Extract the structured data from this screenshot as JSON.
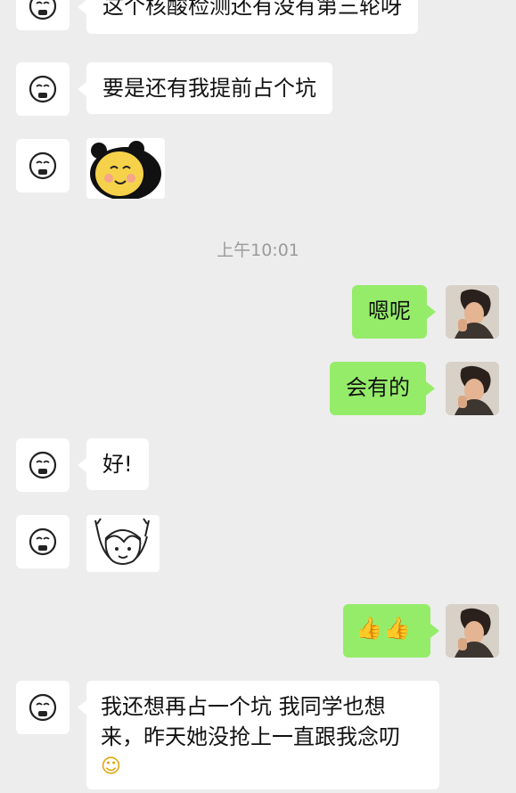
{
  "conversation": {
    "timestamp": "上午10:01",
    "messages": [
      {
        "side": "left",
        "text": "这个核酸检测还有没有第三轮呀"
      },
      {
        "side": "left",
        "text": "要是还有我提前占个坑"
      },
      {
        "side": "left",
        "sticker": "panda-smile-sticker"
      },
      {
        "side": "right",
        "text": "嗯呢"
      },
      {
        "side": "right",
        "text": "会有的"
      },
      {
        "side": "left",
        "text": "好!"
      },
      {
        "side": "left",
        "sticker": "cheering-girl-sticker"
      },
      {
        "side": "right",
        "emoji": "👍👍"
      },
      {
        "side": "left",
        "line1": "我还想再占一个坑 我同学也想",
        "line2": "来，昨天她没抢上一直跟我念叨",
        "emoji": "☺"
      }
    ]
  },
  "colors": {
    "background": "#ededed",
    "incoming_bubble": "#ffffff",
    "outgoing_bubble": "#95ec69",
    "timestamp_text": "#9b9b9b"
  }
}
